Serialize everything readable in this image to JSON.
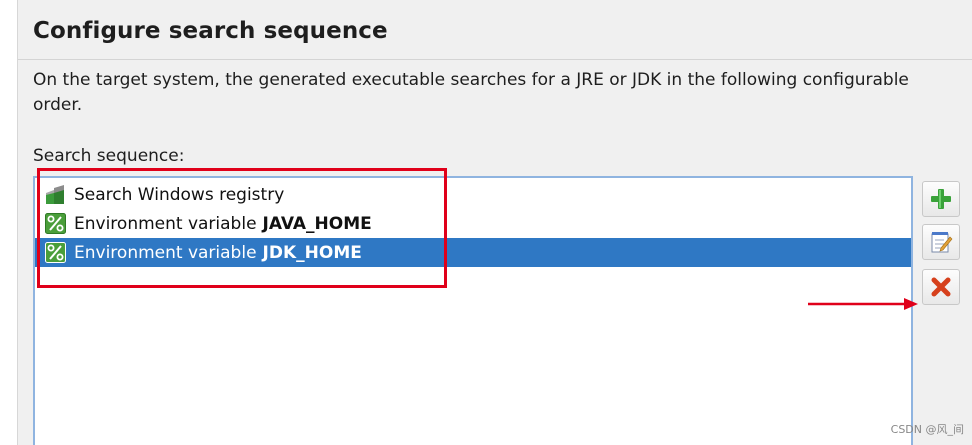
{
  "header": {
    "title": "Configure search sequence",
    "description": "On the target system, the generated executable searches for a JRE or JDK in the following configurable order."
  },
  "sequence": {
    "label": "Search sequence:",
    "items": [
      {
        "prefix": "Search Windows registry",
        "bold": "",
        "icon": "windows-registry-icon",
        "selected": false
      },
      {
        "prefix": "Environment variable",
        "bold": "JAVA_HOME",
        "icon": "percent-icon",
        "selected": false
      },
      {
        "prefix": "Environment variable",
        "bold": "JDK_HOME",
        "icon": "percent-icon",
        "selected": true
      }
    ]
  },
  "buttons": {
    "add_icon": "plus-icon",
    "edit_icon": "edit-icon",
    "remove_icon": "remove-x-icon"
  },
  "watermark": "CSDN @风_间",
  "colors": {
    "selection": "#2f78c4",
    "annotation_red": "#e0001a",
    "add_green": "#3aa23a",
    "remove_orange": "#d6401c"
  }
}
